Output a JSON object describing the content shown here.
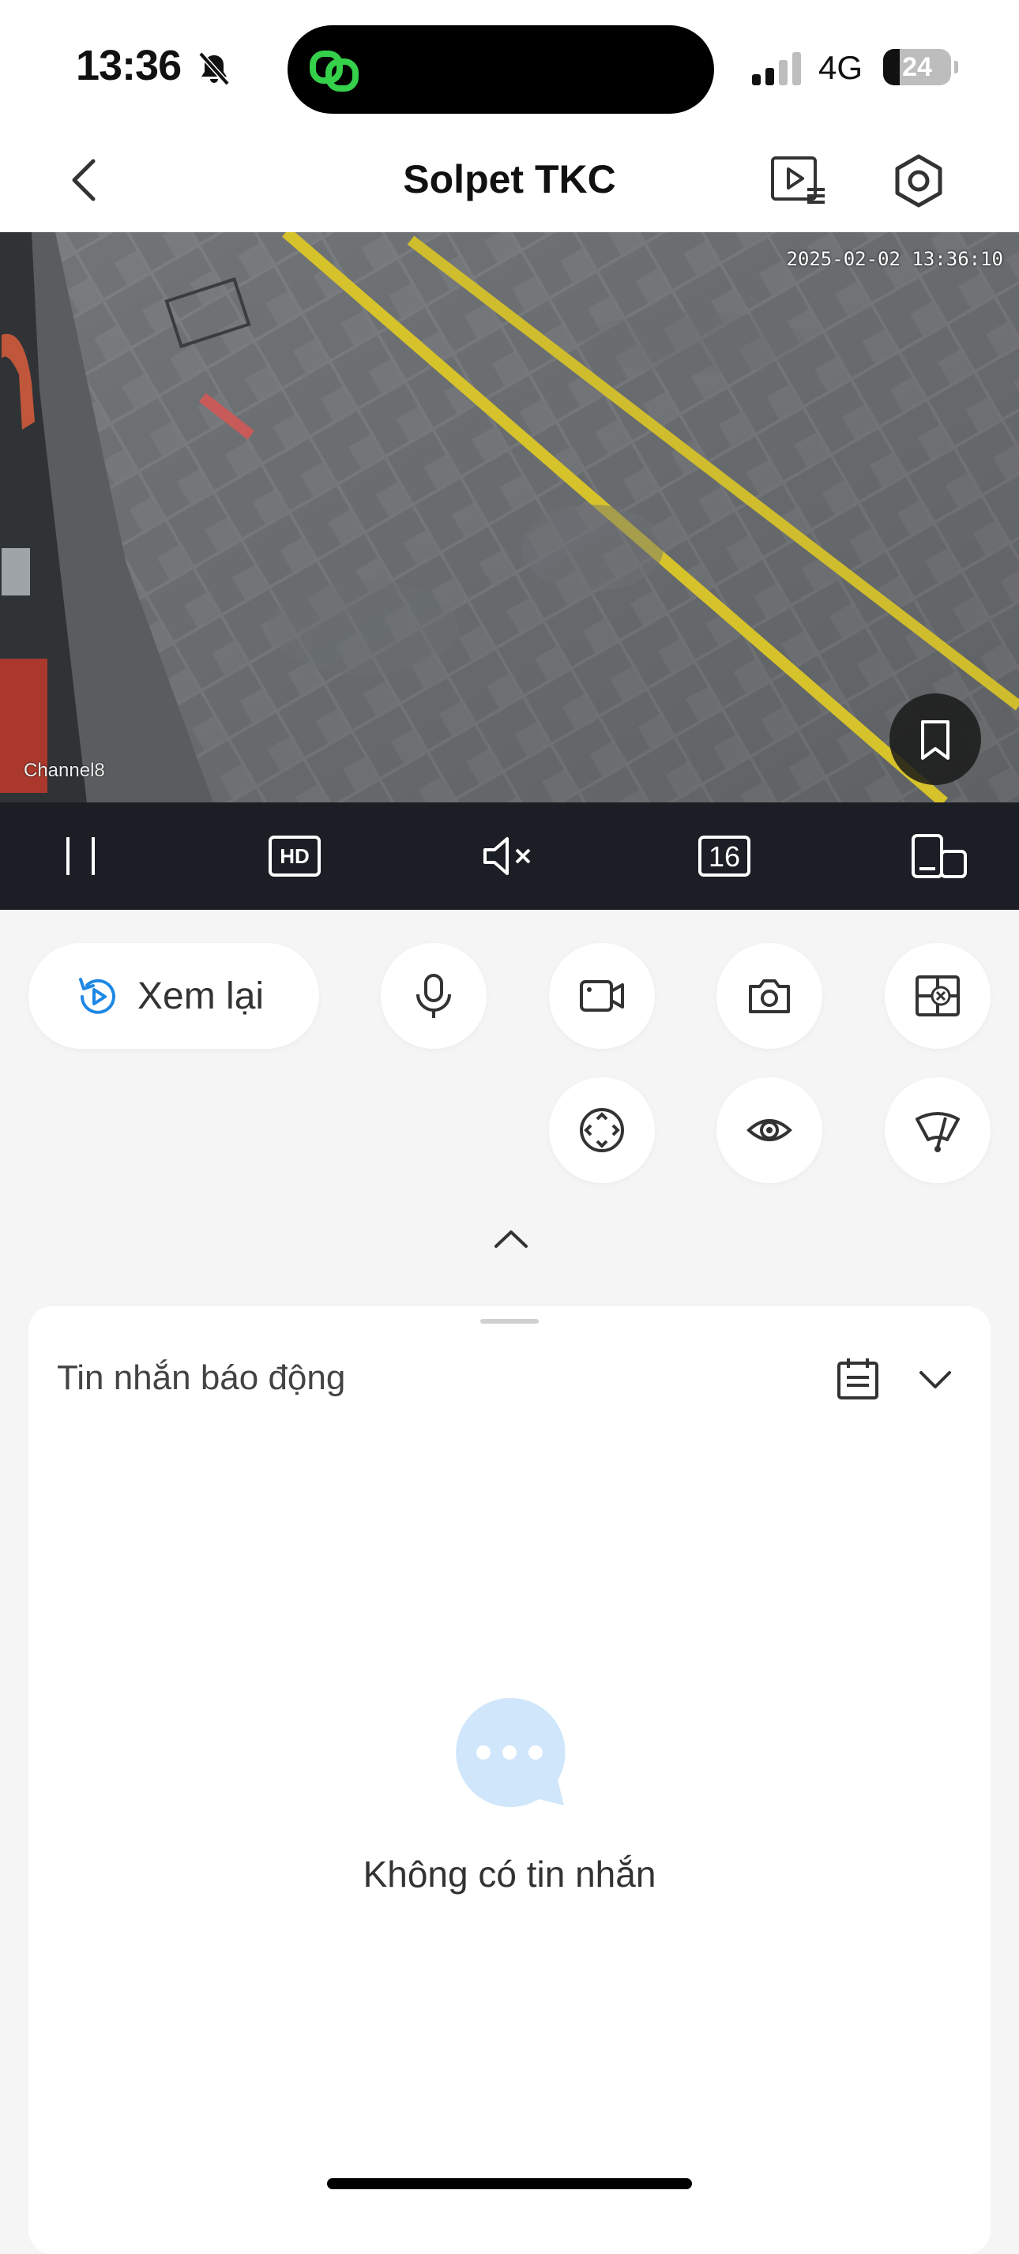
{
  "status_bar": {
    "time": "13:36",
    "network": "4G",
    "battery": "24",
    "battery_level": 0.24
  },
  "header": {
    "title": "Solpet TKC"
  },
  "video": {
    "timestamp": "2025-02-02 13:36:10",
    "channel": "Channel8"
  },
  "video_toolbar": {
    "quality": "HD",
    "split": "16"
  },
  "controls": {
    "playback_label": "Xem lại"
  },
  "alarm_panel": {
    "title": "Tin nhắn báo động",
    "empty_text": "Không có tin nhắn"
  },
  "colors": {
    "accent": "#1e88e5",
    "empty_bubble": "#cfe6fb",
    "toolbar_bg": "#1b1e24",
    "island_app": "#35d14b"
  },
  "icons": {
    "status": [
      "bell-slash-icon",
      "signal-icon",
      "battery-icon"
    ],
    "header": [
      "back-icon",
      "playlist-icon",
      "settings-icon"
    ],
    "video_toolbar": [
      "pause-icon",
      "hd-icon",
      "mute-icon",
      "split-icon",
      "orientation-icon"
    ],
    "controls": [
      "replay-icon",
      "microphone-icon",
      "record-icon",
      "camera-icon",
      "multi-view-icon",
      "ptz-icon",
      "eye-icon",
      "wiper-icon"
    ]
  }
}
